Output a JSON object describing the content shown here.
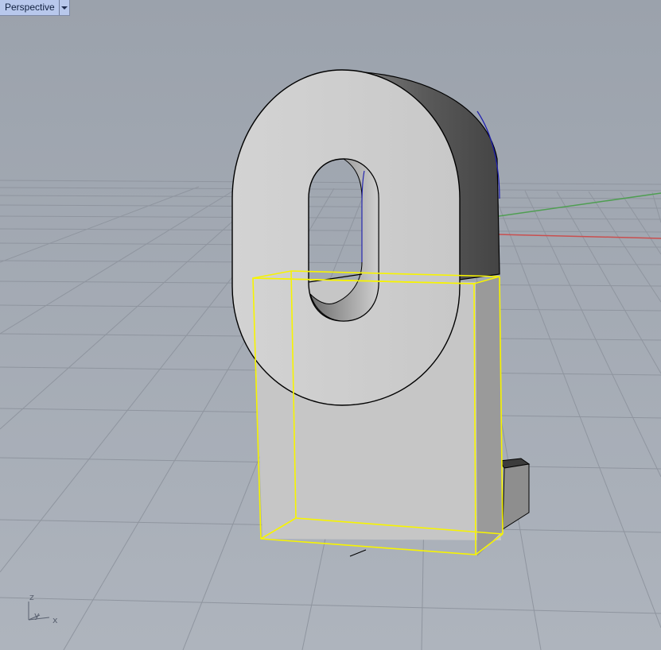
{
  "viewport": {
    "title": "Perspective",
    "dropdown_icon": "chevron-down-icon"
  },
  "axes": {
    "z_label": "z",
    "y_label": "y",
    "x_label": "x",
    "x_color": "#c94f4f",
    "y_color": "#4f9e52"
  },
  "colors": {
    "background": "#a2a9b3",
    "selection": "#f7f400",
    "model_edge": "#000000",
    "model_face": "#d5d5d5",
    "model_shadow": "#8a8a8a",
    "tab_bg": "#b8c8ec"
  }
}
